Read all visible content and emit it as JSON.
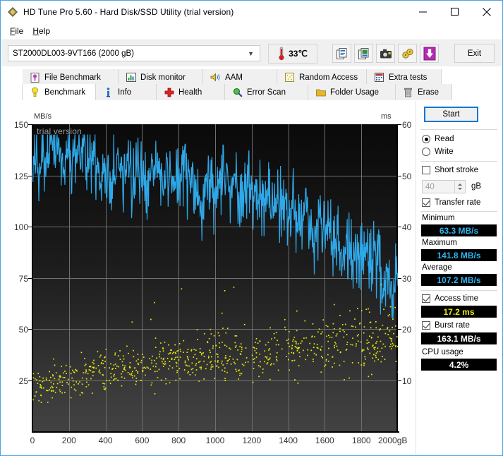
{
  "window": {
    "title": "HD Tune Pro 5.60 - Hard Disk/SSD Utility (trial version)",
    "app_icon": "hdtune-diamond-icon",
    "minimize": "minimize-icon",
    "maximize": "maximize-icon",
    "close": "close-icon"
  },
  "menu": {
    "items": [
      "File",
      "Help"
    ]
  },
  "toolbar": {
    "drive": "ST2000DL003-9VT166 (2000 gB)",
    "temperature": "33℃",
    "buttons": [
      {
        "name": "copy-icon"
      },
      {
        "name": "copy-image-icon"
      },
      {
        "name": "screenshot-camera-icon"
      },
      {
        "name": "plug-connector-icon"
      },
      {
        "name": "download-arrow-icon"
      }
    ],
    "exit_label": "Exit"
  },
  "tabs": {
    "row1": [
      {
        "label": "File Benchmark",
        "icon": "file-benchmark-icon",
        "active": false
      },
      {
        "label": "Disk monitor",
        "icon": "disk-monitor-icon",
        "active": false
      },
      {
        "label": "AAM",
        "icon": "speaker-icon",
        "active": false
      },
      {
        "label": "Random Access",
        "icon": "random-access-icon",
        "active": false
      },
      {
        "label": "Extra tests",
        "icon": "extra-tests-icon",
        "active": false
      }
    ],
    "row2": [
      {
        "label": "Benchmark",
        "icon": "benchmark-bulb-icon",
        "active": true
      },
      {
        "label": "Info",
        "icon": "info-icon",
        "active": false
      },
      {
        "label": "Health",
        "icon": "health-cross-icon",
        "active": false
      },
      {
        "label": "Error Scan",
        "icon": "magnifier-icon",
        "active": false
      },
      {
        "label": "Folder Usage",
        "icon": "folder-icon",
        "active": false
      },
      {
        "label": "Erase",
        "icon": "trash-icon",
        "active": false
      }
    ]
  },
  "panel": {
    "start_label": "Start",
    "mode_read": "Read",
    "mode_write": "Write",
    "mode_selected": "Read",
    "short_stroke_label": "Short stroke",
    "short_stroke_checked": false,
    "short_stroke_value": "40",
    "short_stroke_unit": "gB",
    "transfer_rate_label": "Transfer rate",
    "transfer_rate_checked": true,
    "minimum_label": "Minimum",
    "minimum_value": "63.3 MB/s",
    "maximum_label": "Maximum",
    "maximum_value": "141.8 MB/s",
    "average_label": "Average",
    "average_value": "107.2 MB/s",
    "access_time_label": "Access time",
    "access_time_checked": true,
    "access_time_value": "17.2 ms",
    "burst_rate_label": "Burst rate",
    "burst_rate_checked": true,
    "burst_rate_value": "163.1 MB/s",
    "cpu_usage_label": "CPU usage",
    "cpu_usage_value": "4.2%"
  },
  "colors": {
    "transfer_line": "#2fa8e8",
    "access_dots": "#e8e80f",
    "plot_bg_top": "#0a0a0a",
    "plot_bg_bottom": "#424242",
    "grid": "#6f6f6f",
    "accent_border": "#0a76d1"
  },
  "chart_data": {
    "type": "line",
    "title": "",
    "watermark": "trial version",
    "xlabel": "gB",
    "ylabel": "MB/s",
    "y2label": "ms",
    "xlim": [
      0,
      2000
    ],
    "ylim": [
      0,
      150
    ],
    "y2lim": [
      0,
      60
    ],
    "grid": true,
    "xticks": [
      0,
      200,
      400,
      600,
      800,
      1000,
      1200,
      1400,
      1600,
      1800,
      2000
    ],
    "xticklabels": [
      "0",
      "200",
      "400",
      "600",
      "800",
      "1000",
      "1200",
      "1400",
      "1600",
      "1800",
      "2000gB"
    ],
    "yticks": [
      25,
      50,
      75,
      100,
      125,
      150
    ],
    "yticklabels": [
      "25",
      "50",
      "75",
      "100",
      "125",
      "150"
    ],
    "y2ticks": [
      10,
      20,
      30,
      40,
      50,
      60
    ],
    "y2ticklabels": [
      "10",
      "20",
      "30",
      "40",
      "50",
      "60"
    ],
    "series": [
      {
        "name": "Transfer rate",
        "type": "line",
        "color": "#2fa8e8",
        "axis": "left",
        "units": "MB/s",
        "x": [
          0,
          10,
          20,
          30,
          40,
          50,
          60,
          70,
          80,
          90,
          100,
          110,
          120,
          130,
          140,
          150,
          160,
          170,
          180,
          190,
          200,
          210,
          220,
          230,
          240,
          250,
          260,
          270,
          280,
          290,
          300,
          310,
          320,
          330,
          340,
          350,
          360,
          370,
          380,
          390,
          400,
          410,
          420,
          430,
          440,
          450,
          460,
          470,
          480,
          490,
          500,
          510,
          520,
          530,
          540,
          550,
          560,
          570,
          580,
          590,
          600,
          610,
          620,
          630,
          640,
          650,
          660,
          670,
          680,
          690,
          700,
          710,
          720,
          730,
          740,
          750,
          760,
          770,
          780,
          790,
          800,
          810,
          820,
          830,
          840,
          850,
          860,
          870,
          880,
          890,
          900,
          910,
          920,
          930,
          940,
          950,
          960,
          970,
          980,
          990,
          1000,
          1010,
          1020,
          1030,
          1040,
          1050,
          1060,
          1070,
          1080,
          1090,
          1100,
          1110,
          1120,
          1130,
          1140,
          1150,
          1160,
          1170,
          1180,
          1190,
          1200,
          1210,
          1220,
          1230,
          1240,
          1250,
          1260,
          1270,
          1280,
          1290,
          1300,
          1310,
          1320,
          1330,
          1340,
          1350,
          1360,
          1370,
          1380,
          1390,
          1400,
          1410,
          1420,
          1430,
          1440,
          1450,
          1460,
          1470,
          1480,
          1490,
          1500,
          1510,
          1520,
          1530,
          1540,
          1550,
          1560,
          1570,
          1580,
          1590,
          1600,
          1610,
          1620,
          1630,
          1640,
          1650,
          1660,
          1670,
          1680,
          1690,
          1700,
          1710,
          1720,
          1730,
          1740,
          1750,
          1760,
          1770,
          1780,
          1790,
          1800,
          1810,
          1820,
          1830,
          1840,
          1850,
          1860,
          1870,
          1880,
          1890,
          1900,
          1910,
          1920,
          1930,
          1940,
          1950,
          1960,
          1970,
          1980,
          1990,
          2000
        ],
        "y": [
          126,
          130,
          133,
          129,
          131,
          135,
          138,
          134,
          131,
          136,
          140,
          137,
          133,
          136,
          139,
          136,
          132,
          129,
          135,
          138,
          134,
          131,
          136,
          141,
          138,
          135,
          132,
          136,
          139,
          135,
          131,
          128,
          132,
          137,
          134,
          130,
          126,
          122,
          127,
          131,
          127,
          123,
          119,
          124,
          128,
          125,
          130,
          134,
          131,
          127,
          124,
          128,
          132,
          128,
          124,
          120,
          124,
          129,
          132,
          128,
          124,
          120,
          116,
          121,
          126,
          130,
          127,
          123,
          128,
          132,
          128,
          124,
          120,
          125,
          129,
          125,
          121,
          117,
          122,
          127,
          123,
          126,
          130,
          127,
          123,
          119,
          124,
          129,
          125,
          121,
          117,
          113,
          108,
          112,
          117,
          122,
          126,
          123,
          119,
          115,
          111,
          116,
          121,
          124,
          120,
          124,
          127,
          124,
          120,
          117,
          120,
          123,
          120,
          117,
          120,
          122,
          119,
          116,
          119,
          121,
          118,
          115,
          117,
          119,
          116,
          113,
          110,
          114,
          118,
          115,
          111,
          107,
          110,
          114,
          111,
          108,
          112,
          115,
          112,
          108,
          105,
          109,
          113,
          110,
          106,
          102,
          98,
          102,
          106,
          110,
          107,
          103,
          99,
          95,
          92,
          96,
          100,
          104,
          101,
          97,
          93,
          96,
          100,
          97,
          93,
          89,
          92,
          96,
          93,
          89,
          86,
          90,
          94,
          91,
          87,
          84,
          88,
          92,
          89,
          85,
          82,
          86,
          90,
          87,
          83,
          80,
          84,
          88,
          85,
          81,
          78,
          74,
          70,
          74,
          78,
          74,
          70,
          67,
          70,
          74,
          71,
          67,
          64,
          68,
          72,
          69,
          66,
          63
        ]
      },
      {
        "name": "Access time",
        "type": "scatter",
        "color": "#e8e80f",
        "axis": "right",
        "units": "ms",
        "average": 17.2
      }
    ],
    "summary": {
      "minimum_mbs": 63.3,
      "maximum_mbs": 141.8,
      "average_mbs": 107.2,
      "access_time_ms": 17.2,
      "burst_rate_mbs": 163.1,
      "cpu_usage_pct": 4.2
    }
  }
}
